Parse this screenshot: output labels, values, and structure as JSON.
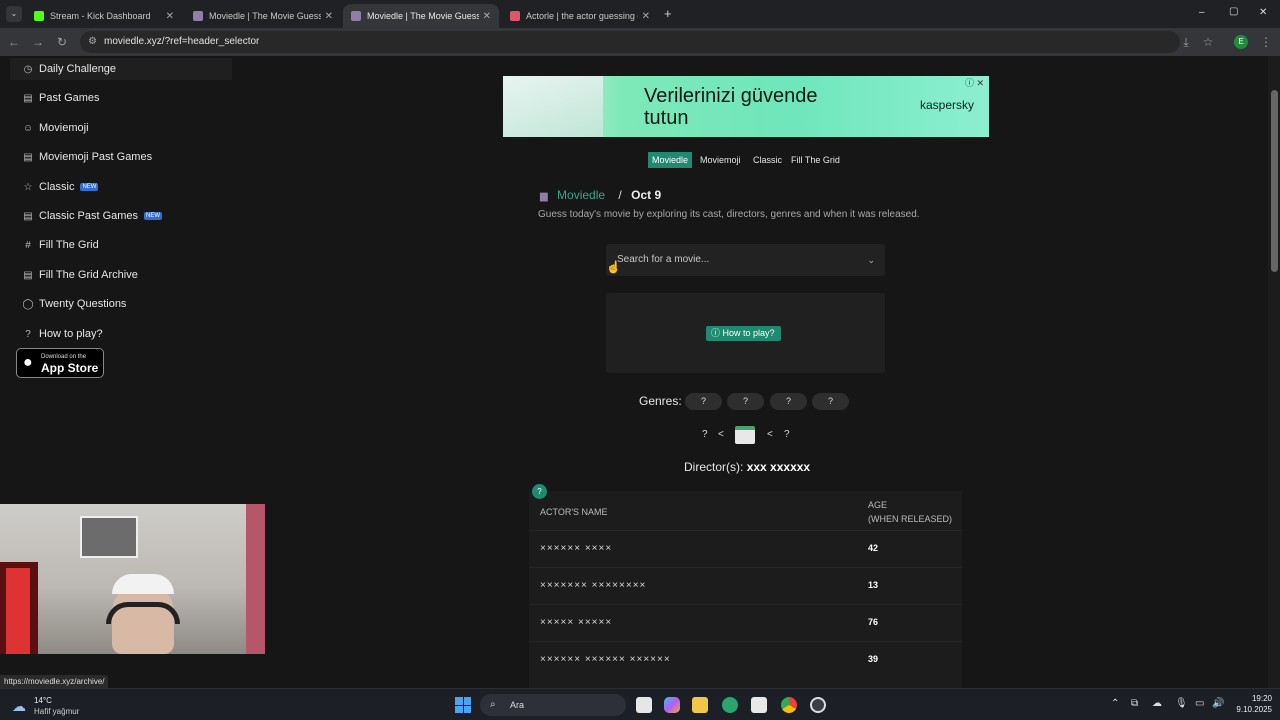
{
  "browser": {
    "tabs": [
      {
        "title": "Stream - Kick Dashboard",
        "favicon_color": "#53fc18",
        "active": false
      },
      {
        "title": "Moviedle | The Movie Guessing",
        "favicon_color": "#8e7ea8",
        "active": false
      },
      {
        "title": "Moviedle | The Movie Guessing",
        "favicon_color": "#8e7ea8",
        "active": true
      },
      {
        "title": "Actorle | the actor guessing ga",
        "favicon_color": "#e0566b",
        "active": false
      }
    ],
    "new_tab_glyph": "+",
    "window_controls": {
      "minimize": "–",
      "maximize": "▢",
      "close": "✕"
    },
    "url": "moviedle.xyz/?ref=header_selector",
    "profile_initial": "E"
  },
  "sidebar": {
    "items": [
      {
        "label": "Daily Challenge",
        "icon": "clock-icon",
        "glyph": "◷",
        "new": false
      },
      {
        "label": "Past Games",
        "icon": "calendar-icon",
        "glyph": "▤",
        "new": false
      },
      {
        "label": "Moviemoji",
        "icon": "smile-icon",
        "glyph": "☺",
        "new": false
      },
      {
        "label": "Moviemoji Past Games",
        "icon": "calendar-icon",
        "glyph": "▤",
        "new": false
      },
      {
        "label": "Classic",
        "icon": "star-icon",
        "glyph": "☆",
        "new": true
      },
      {
        "label": "Classic Past Games",
        "icon": "calendar-icon",
        "glyph": "▤",
        "new": true
      },
      {
        "label": "Fill The Grid",
        "icon": "hash-icon",
        "glyph": "#",
        "new": false
      },
      {
        "label": "Fill The Grid Archive",
        "icon": "calendar-icon",
        "glyph": "▤",
        "new": false
      },
      {
        "label": "Twenty Questions",
        "icon": "chat-icon",
        "glyph": "◯",
        "new": false
      },
      {
        "label": "How to play?",
        "icon": "help-icon",
        "glyph": "?",
        "new": false
      }
    ],
    "new_badge": "NEW",
    "app_store": {
      "line1": "Download on the",
      "line2": "App Store"
    }
  },
  "ad": {
    "headline_1": "Verilerinizi güvende",
    "headline_2": "tutun",
    "brand": "kaspersky",
    "close": "ⓘ ✕"
  },
  "modes": [
    {
      "label": "Moviedle",
      "active": true
    },
    {
      "label": "Moviemoji",
      "active": false
    },
    {
      "label": "Classic",
      "active": false
    },
    {
      "label": "Fill The Grid",
      "active": false
    }
  ],
  "game": {
    "breadcrumb_link": "Moviedle",
    "breadcrumb_sep": "/",
    "date": "Oct 9",
    "subtitle": "Guess today's movie by exploring its cast, directors, genres and when it was released.",
    "search_placeholder": "Search for a movie...",
    "how_to_play": "How to play?",
    "genres_label": "Genres:",
    "genres": [
      "?",
      "?",
      "?",
      "?"
    ],
    "year_left": "?",
    "year_lt1": "<",
    "year_lt2": "<",
    "year_right": "?",
    "director_label": "Director(s):",
    "director_value": "xxx xxxxxx",
    "hint_badge": "?",
    "table": {
      "col_name": "ACTOR'S NAME",
      "col_age": "AGE",
      "col_age_sub": "(WHEN RELEASED)",
      "rows": [
        {
          "name": "×××××× ××××",
          "age": "42"
        },
        {
          "name": "××××××× ××××××××",
          "age": "13"
        },
        {
          "name": "××××× ×××××",
          "age": "76"
        },
        {
          "name": "×××××× ×××××× ××××××",
          "age": "39"
        }
      ]
    }
  },
  "status_url": "https://moviedle.xyz/archive/",
  "taskbar": {
    "weather_temp": "14°C",
    "weather_desc": "Hafif yağmur",
    "search_placeholder": "Ara",
    "time": "19:20",
    "date": "9.10.2025"
  }
}
